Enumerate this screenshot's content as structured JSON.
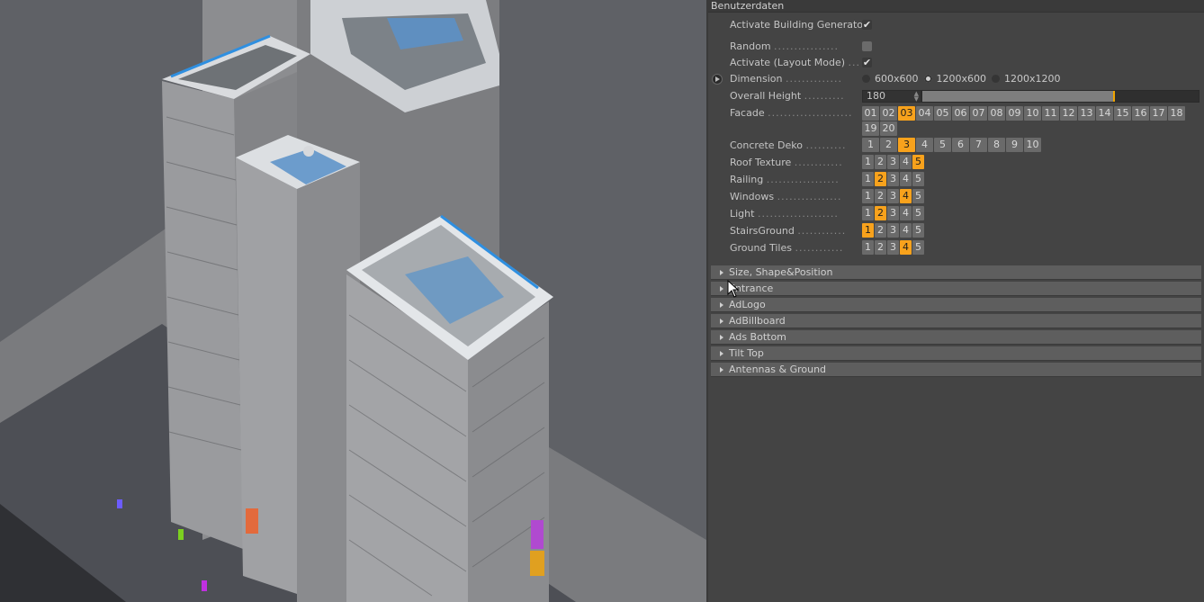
{
  "viewport": {
    "description": "3D render of isometric high-rise building complex",
    "background_color": "#5f6166"
  },
  "panel": {
    "title": "Benutzerdaten",
    "accent_color": "#f8a21c",
    "rows": {
      "activate_generator": {
        "label": "Activate Building Generator",
        "checked": true,
        "check_glyph": "✔"
      },
      "random": {
        "label": "Random",
        "dots": "................",
        "checked": false
      },
      "activate_layout": {
        "label": "Activate (Layout Mode)",
        "dots": "....",
        "checked": true,
        "check_glyph": "✔"
      },
      "dimension": {
        "label": "Dimension",
        "dots": "..............",
        "options": [
          "600x600",
          "1200x600",
          "1200x1200"
        ],
        "selected": "1200x600"
      },
      "overall_height": {
        "label": "Overall Height",
        "dots": "..........",
        "value": "180",
        "spinner_glyph": "▲▼",
        "slider_fraction": 0.69
      },
      "facade": {
        "label": "Facade",
        "dots": ".....................",
        "options": [
          "01",
          "02",
          "03",
          "04",
          "05",
          "06",
          "07",
          "08",
          "09",
          "10",
          "11",
          "12",
          "13",
          "14",
          "15",
          "16",
          "17",
          "18",
          "19",
          "20"
        ],
        "selected": "03"
      },
      "concrete_deko": {
        "label": "Concrete Deko",
        "dots": "..........",
        "options": [
          "1",
          "2",
          "3",
          "4",
          "5",
          "6",
          "7",
          "8",
          "9",
          "10"
        ],
        "selected": "3"
      },
      "roof_texture": {
        "label": "Roof Texture",
        "dots": "............",
        "options": [
          "1",
          "2",
          "3",
          "4",
          "5"
        ],
        "selected": "5"
      },
      "railing": {
        "label": "Railing",
        "dots": "..................",
        "options": [
          "1",
          "2",
          "3",
          "4",
          "5"
        ],
        "selected": "2"
      },
      "windows": {
        "label": "Windows",
        "dots": "................",
        "options": [
          "1",
          "2",
          "3",
          "4",
          "5"
        ],
        "selected": "4"
      },
      "light": {
        "label": "Light",
        "dots": "....................",
        "options": [
          "1",
          "2",
          "3",
          "4",
          "5"
        ],
        "selected": "2"
      },
      "stairs_ground": {
        "label": "StairsGround",
        "dots": "............",
        "options": [
          "1",
          "2",
          "3",
          "4",
          "5"
        ],
        "selected": "1"
      },
      "ground_tiles": {
        "label": "Ground Tiles",
        "dots": "............",
        "options": [
          "1",
          "2",
          "3",
          "4",
          "5"
        ],
        "selected": "4"
      }
    },
    "groups": [
      {
        "label": "Size, Shape&Position"
      },
      {
        "label": "Entrance"
      },
      {
        "label": "AdLogo"
      },
      {
        "label": "AdBillboard"
      },
      {
        "label": "Ads Bottom"
      },
      {
        "label": "Tilt Top"
      },
      {
        "label": "Antennas & Ground"
      }
    ]
  }
}
